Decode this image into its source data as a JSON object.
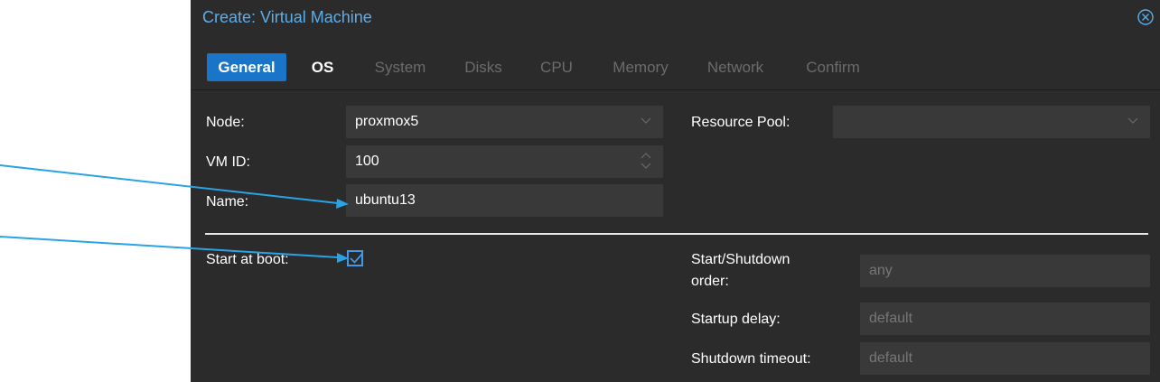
{
  "dialog": {
    "title": "Create: Virtual Machine",
    "close_icon": "close-circle-icon"
  },
  "tabs": [
    {
      "label": "General",
      "state": "active"
    },
    {
      "label": "OS",
      "state": "enabled"
    },
    {
      "label": "System",
      "state": "disabled"
    },
    {
      "label": "Disks",
      "state": "disabled"
    },
    {
      "label": "CPU",
      "state": "disabled"
    },
    {
      "label": "Memory",
      "state": "disabled"
    },
    {
      "label": "Network",
      "state": "disabled"
    },
    {
      "label": "Confirm",
      "state": "disabled"
    }
  ],
  "form": {
    "node_label": "Node:",
    "node_value": "proxmox5",
    "vmid_label": "VM ID:",
    "vmid_value": "100",
    "name_label": "Name:",
    "name_value": "ubuntu13",
    "resource_pool_label": "Resource Pool:",
    "resource_pool_value": "",
    "start_at_boot_label": "Start at boot:",
    "start_at_boot_checked": true,
    "start_shutdown_order_label_line1": "Start/Shutdown",
    "start_shutdown_order_label_line2": "order:",
    "start_shutdown_order_placeholder": "any",
    "startup_delay_label": "Startup delay:",
    "startup_delay_placeholder": "default",
    "shutdown_timeout_label": "Shutdown timeout:",
    "shutdown_timeout_placeholder": "default"
  },
  "colors": {
    "accent": "#1a74c8",
    "title": "#5aaeea",
    "annotation_arrow": "#29a3e6",
    "dialog_bg": "#2b2b2b",
    "field_bg": "#393939"
  }
}
